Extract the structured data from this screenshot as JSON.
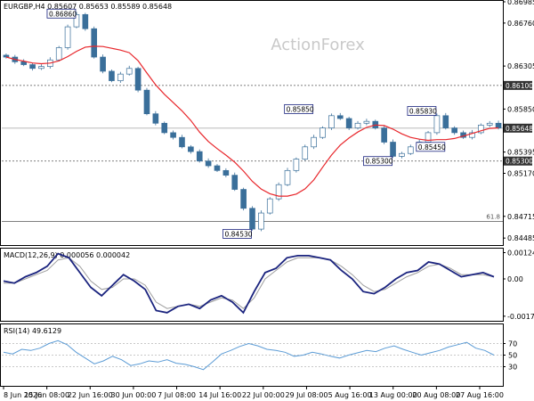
{
  "header": {
    "symbol_line": "EURGBP,H4  0.85607 0.85653 0.85589 0.85648",
    "watermark": "ActionForex"
  },
  "colors": {
    "candles": "#3a6f9a",
    "ma": "#e8262b",
    "macd": "#1a237e",
    "signal": "#9e9e9e",
    "rsi": "#5b9bd5",
    "label_border": "#1a237e",
    "price_tag_bg": "#333333"
  },
  "chart_data": [
    {
      "type": "line",
      "panel": "price",
      "title": "EURGBP,H4  0.85607 0.85653 0.85589 0.85648",
      "ylim": [
        0.8443,
        0.86985
      ],
      "y_ticks": [
        "0.86985",
        "0.86760",
        "0.86305",
        "0.85850",
        "0.85395",
        "0.85170",
        "0.84715",
        "0.84485"
      ],
      "x_categories": [
        "8 Jun 2026",
        "15 Jun 08:00",
        "22 Jun 16:00",
        "30 Jun 00:00",
        "7 Jul 08:00",
        "14 Jul 16:00",
        "22 Jul 00:00",
        "29 Jul 08:00",
        "5 Aug 16:00",
        "13 Aug 00:00",
        "20 Aug 08:00",
        "27 Aug 16:00"
      ],
      "series": [
        {
          "kind": "candles",
          "close": [
            0.864,
            0.8635,
            0.8632,
            0.8628,
            0.863,
            0.8637,
            0.865,
            0.8672,
            0.8685,
            0.867,
            0.864,
            0.8625,
            0.8615,
            0.8622,
            0.8628,
            0.8605,
            0.858,
            0.857,
            0.856,
            0.8555,
            0.8545,
            0.854,
            0.853,
            0.8525,
            0.852,
            0.8515,
            0.85,
            0.848,
            0.8458,
            0.8475,
            0.849,
            0.8505,
            0.852,
            0.8532,
            0.8545,
            0.8555,
            0.8565,
            0.8578,
            0.8575,
            0.8565,
            0.857,
            0.8572,
            0.8565,
            0.855,
            0.8535,
            0.8538,
            0.8545,
            0.855,
            0.856,
            0.8578,
            0.8565,
            0.856,
            0.8555,
            0.856,
            0.8568,
            0.857,
            0.8565
          ]
        },
        {
          "kind": "moving-average",
          "values": []
        }
      ],
      "horizontal_levels": [
        {
          "value": 0.861,
          "label": "0.86100"
        },
        {
          "value": 0.85648,
          "label": "0.85648",
          "current": true
        },
        {
          "value": 0.853,
          "label": "0.85300"
        },
        {
          "value": 0.8466,
          "label": "61.8"
        }
      ],
      "annotations": [
        {
          "text": "0.86860",
          "value": 0.8686,
          "at_category": 8
        },
        {
          "text": "0.85850",
          "value": 0.8585,
          "at_category": 35
        },
        {
          "text": "0.85830",
          "value": 0.8583,
          "at_category": 49
        },
        {
          "text": "0.85450",
          "value": 0.8545,
          "at_category": 50
        },
        {
          "text": "0.85300",
          "value": 0.853,
          "at_category": 44
        },
        {
          "text": "0.84530",
          "value": 0.8453,
          "at_category": 28
        }
      ]
    },
    {
      "type": "line",
      "panel": "macd",
      "title": "MACD(12,26,9) 0.000056 0.000042",
      "ylim": [
        -0.0019,
        0.00135
      ],
      "y_ticks": [
        "0.001244",
        "0.00",
        "-0.001767"
      ],
      "series": [
        {
          "name": "MACD",
          "values": [
            -0.0001,
            -0.0002,
            0.0001,
            0.0003,
            0.0006,
            0.0012,
            0.001,
            0.0003,
            -0.0004,
            -0.0008,
            -0.0003,
            0.0002,
            -0.0001,
            -0.0005,
            -0.0015,
            -0.0016,
            -0.0013,
            -0.0012,
            -0.0014,
            -0.001,
            -0.0008,
            -0.0011,
            -0.0016,
            -0.0006,
            0.0003,
            0.0005,
            0.001,
            0.0011,
            0.0011,
            0.001,
            0.0009,
            0.0004,
            0.0,
            -0.0006,
            -0.0007,
            -0.0004,
            0.0,
            0.0003,
            0.0004,
            0.0008,
            0.0007,
            0.0004,
            0.0001,
            0.0002,
            0.0003,
            0.0001
          ]
        },
        {
          "name": "Signal",
          "values": [
            -0.0002,
            -0.0002,
            0.0,
            0.0002,
            0.0004,
            0.0009,
            0.001,
            0.0006,
            -0.0001,
            -0.0005,
            -0.0004,
            0.0,
            0.0,
            -0.0003,
            -0.0011,
            -0.0014,
            -0.0013,
            -0.0012,
            -0.0013,
            -0.0011,
            -0.0009,
            -0.001,
            -0.0014,
            -0.0009,
            0.0,
            0.0004,
            0.0008,
            0.001,
            0.001,
            0.001,
            0.0009,
            0.0006,
            0.0002,
            -0.0003,
            -0.0006,
            -0.0005,
            -0.0002,
            0.0001,
            0.0003,
            0.0006,
            0.0007,
            0.0005,
            0.0002,
            0.0002,
            0.0002,
            0.0001
          ]
        }
      ]
    },
    {
      "type": "line",
      "panel": "rsi",
      "title": "RSI(14) 49.6129",
      "ylim": [
        0,
        100
      ],
      "y_ticks": [
        "70",
        "50",
        "30"
      ],
      "series": [
        {
          "name": "RSI(14)",
          "values": [
            55,
            52,
            60,
            58,
            62,
            70,
            75,
            68,
            55,
            45,
            35,
            40,
            48,
            42,
            32,
            35,
            40,
            38,
            42,
            36,
            34,
            30,
            25,
            38,
            52,
            58,
            65,
            70,
            66,
            60,
            58,
            55,
            48,
            50,
            55,
            52,
            48,
            45,
            50,
            54,
            58,
            56,
            62,
            66,
            60,
            55,
            50,
            54,
            58,
            64,
            68,
            72,
            62,
            58,
            50
          ]
        }
      ]
    }
  ]
}
